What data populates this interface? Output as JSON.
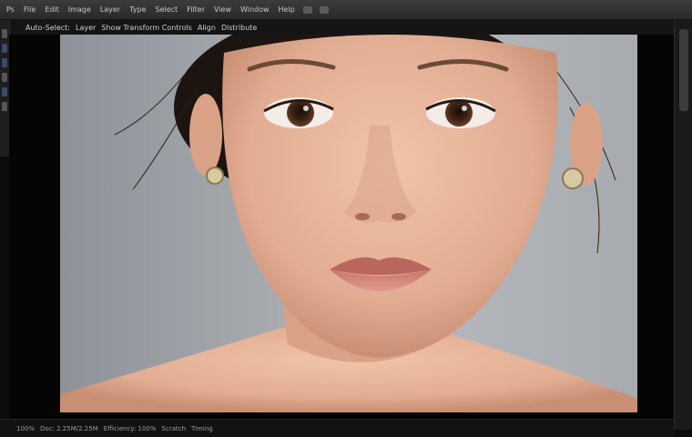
{
  "menubar": {
    "items": [
      "Ps",
      "File",
      "Edit",
      "Image",
      "Layer",
      "Type",
      "Select",
      "Filter",
      "View",
      "Window",
      "Help"
    ]
  },
  "optionsbar": {
    "items": [
      "Auto-Select:",
      "Layer",
      "Show Transform Controls",
      "Align",
      "Distribute"
    ]
  },
  "status": {
    "items": [
      "100%",
      "Doc: 2.25M/2.25M",
      "Efficiency: 100%",
      "Scratch",
      "Timing"
    ]
  },
  "colors": {
    "app_background": "#0c0c0c",
    "menubar": "#2f2f2f",
    "photo_background": "#a9adb2",
    "skin": "#e8b9a0",
    "lips": "#d98a80",
    "hair": "#1b1411"
  },
  "icons": [
    "move-tool-icon",
    "marquee-tool-icon",
    "lasso-tool-icon",
    "crop-tool-icon",
    "brush-tool-icon",
    "eraser-tool-icon"
  ]
}
